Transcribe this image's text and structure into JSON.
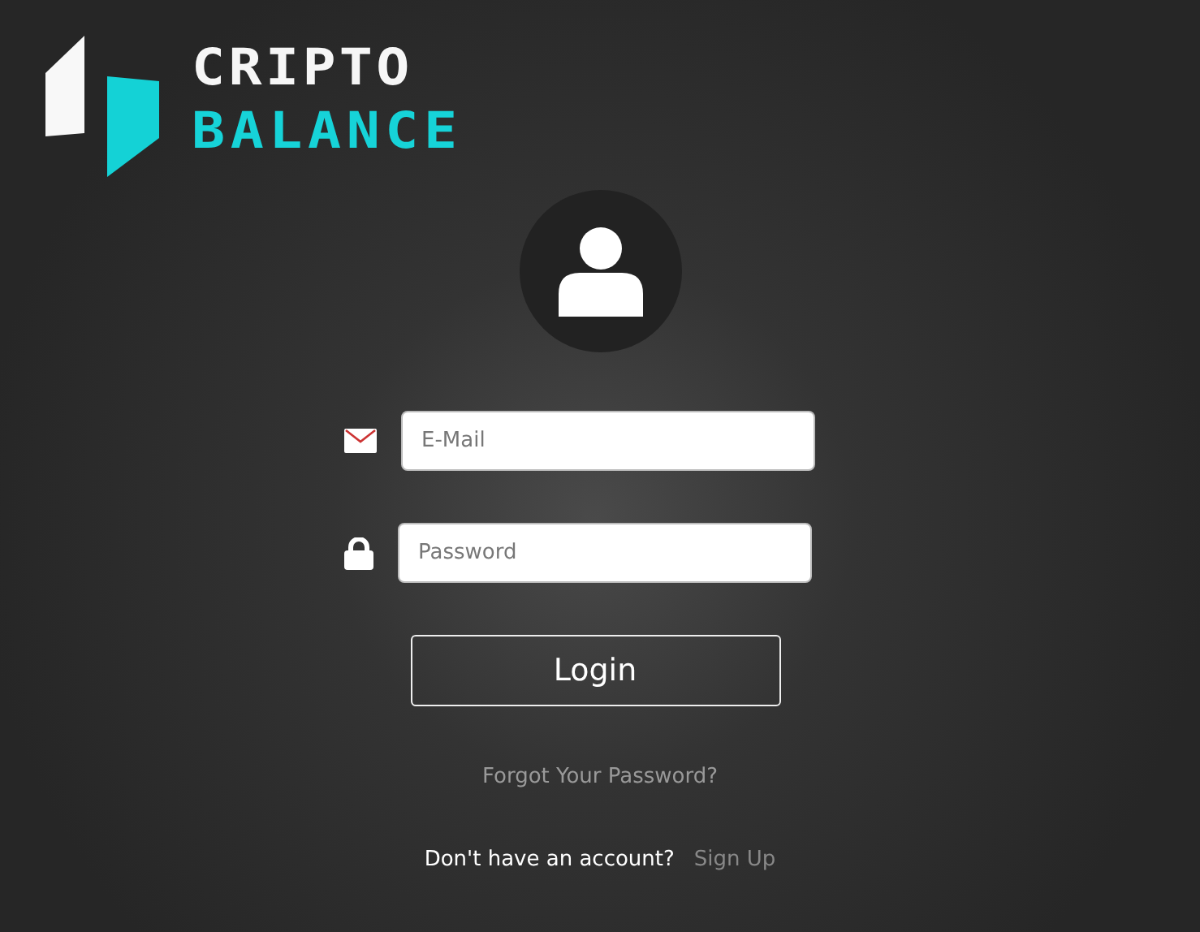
{
  "logo": {
    "line_1": "CRIPTO",
    "line_2": "BALANCE"
  },
  "fields": [
    {
      "kind": "email",
      "placeholder": "E-Mail"
    },
    {
      "kind": "password",
      "placeholder": "Password"
    }
  ],
  "login_button": "Login",
  "forgot_link": "Forgot Your Password?",
  "signup": {
    "prompt": "Don't have an account?",
    "link": "Sign Up"
  }
}
